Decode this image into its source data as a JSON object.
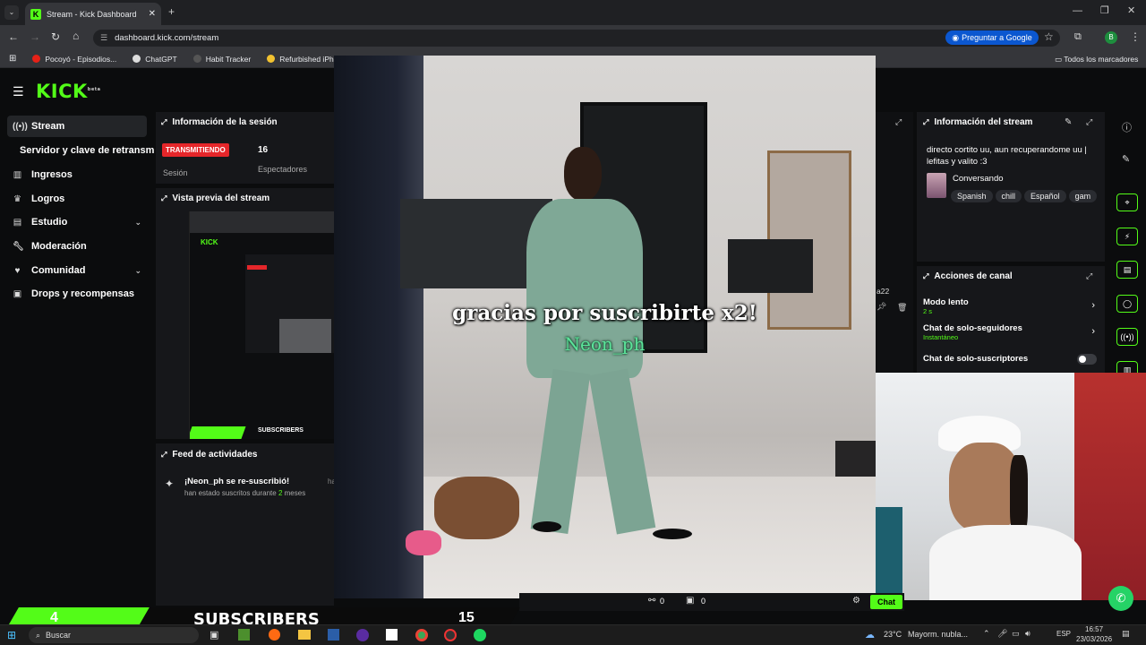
{
  "browser": {
    "tab_title": "Stream - Kick Dashboard",
    "url": "dashboard.kick.com/stream",
    "ask_google": "Preguntar a Google",
    "profile_initial": "B",
    "bookmarks": [
      "Pocoyó - Episodios...",
      "ChatGPT",
      "Habit Tracker",
      "Refurbished iPhone..."
    ],
    "all_bookmarks": "Todos los marcadores"
  },
  "sidebar": {
    "logo": "KICK",
    "logo_badge": "beta",
    "items": [
      {
        "label": "Stream"
      },
      {
        "label": "Servidor y clave de retransm"
      },
      {
        "label": "Ingresos"
      },
      {
        "label": "Logros"
      },
      {
        "label": "Estudio"
      },
      {
        "label": "Moderación"
      },
      {
        "label": "Comunidad"
      },
      {
        "label": "Drops y recompensas"
      }
    ]
  },
  "session": {
    "title": "Información de la sesión",
    "status": "TRANSMITIENDO",
    "status_label": "Sesión",
    "viewers": "16",
    "viewers_label": "Espectadores"
  },
  "preview": {
    "title": "Vista previa del stream",
    "overlay_text": "SUBSCRIBERS"
  },
  "feed": {
    "title": "Feed de actividades",
    "event_title": "¡Neon_ph se re-suscribió!",
    "event_desc_pre": "han estado suscritos durante ",
    "event_months": "2",
    "event_desc_post": " meses",
    "event_time": "ha"
  },
  "overlay": {
    "alert_line1": "gracias por suscribirte x2!",
    "alert_line2": "Neon_ph"
  },
  "stream_info": {
    "title": "Información del stream",
    "stream_title": "directo cortito uu, aun recuperandome uu | lefitas y valito :3",
    "category": "Conversando",
    "tags": [
      "Spanish",
      "chill",
      "Español",
      "gam"
    ]
  },
  "channel_actions": {
    "title": "Acciones de canal",
    "items": [
      {
        "label": "Modo lento",
        "sub": "2 s"
      },
      {
        "label": "Chat de solo-seguidores",
        "sub": "Instantáneo"
      },
      {
        "label": "Chat de solo-suscriptores",
        "sub": ""
      }
    ]
  },
  "chat_partial": {
    "user": "a22"
  },
  "bottom_stats": {
    "links": "0",
    "gifts": "0",
    "chat_button": "Chat"
  },
  "sub_bar": {
    "left_count": "4",
    "label": "SUBSCRIBERS",
    "right_count": "15"
  },
  "taskbar": {
    "search": "Buscar",
    "weather": "23°C",
    "weather_desc": "Mayorm. nubla...",
    "lang": "ESP",
    "time": "16:57",
    "date": "23/03/2026"
  },
  "colors": {
    "accent": "#53fc18",
    "live": "#e5262a"
  }
}
